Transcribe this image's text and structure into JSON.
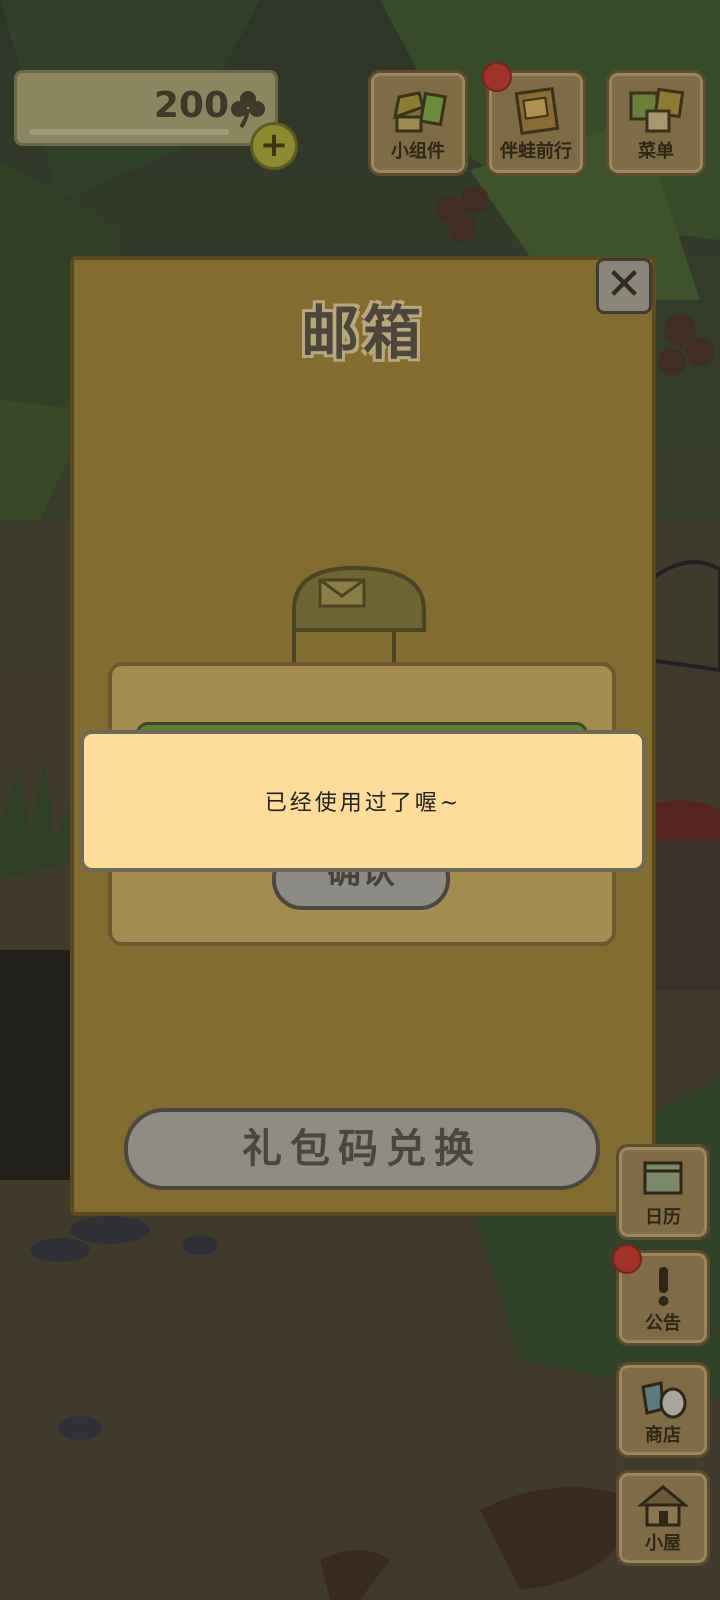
{
  "hud": {
    "coins": "200",
    "plus": "+",
    "top_buttons": [
      {
        "label": "小组件",
        "icon": "widget-icon"
      },
      {
        "label": "伴蛙前行",
        "icon": "journey-icon"
      },
      {
        "label": "菜单",
        "icon": "menu-icon"
      }
    ],
    "side_buttons": [
      {
        "label": "日历",
        "icon": "calendar-icon"
      },
      {
        "label": "公告",
        "icon": "notice-icon"
      },
      {
        "label": "商店",
        "icon": "shop-icon"
      },
      {
        "label": "小屋",
        "icon": "house-icon"
      }
    ]
  },
  "mailbox": {
    "title": "邮箱",
    "close": "✕",
    "confirm_label": "确认",
    "redeem_label": "礼包码兑换"
  },
  "toast": {
    "message": "已经使用过了喔~"
  },
  "colors": {
    "panel": "#836c30",
    "toast_bg": "#fedd9a",
    "notification_dot": "#a0322a"
  }
}
